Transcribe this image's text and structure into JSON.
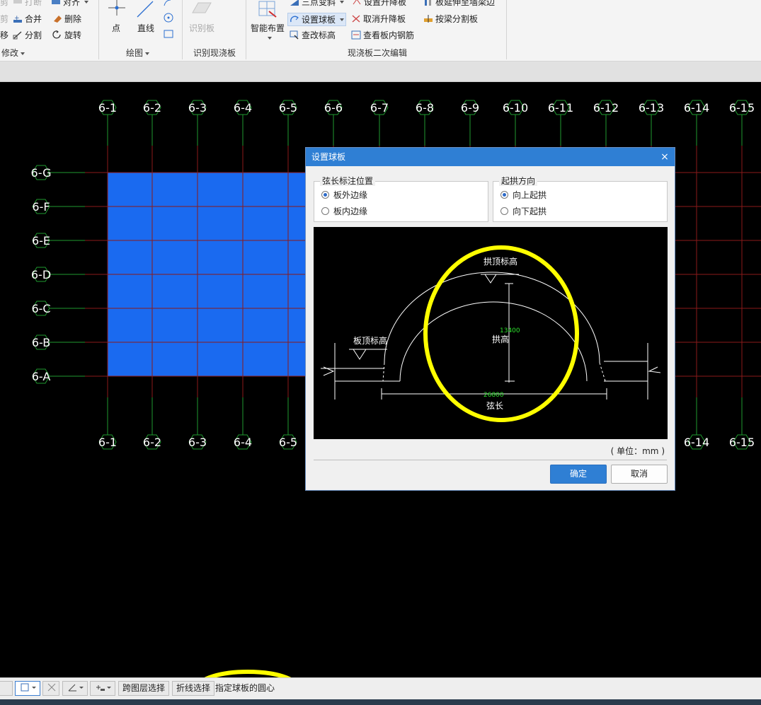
{
  "ribbon": {
    "modify": {
      "break": "打断",
      "align": "对齐",
      "merge": "合并",
      "delete": "删除",
      "split": "分割",
      "rotate": "旋转",
      "cut_partial": "剪",
      "move_partial": "移",
      "group_label": "修改"
    },
    "draw": {
      "point": "点",
      "line": "直线",
      "group_label": "绘图"
    },
    "identify": {
      "identify_slab": "识别板",
      "group_label": "识别现浇板"
    },
    "edit": {
      "smart_layout": "智能布置",
      "three_point_slope": "三点变斜",
      "set_lift_slab": "设置升降板",
      "extend_slab": "板延伸至墙梁边",
      "set_spherical_slab": "设置球板",
      "cancel_lift_slab": "取消升降板",
      "split_by_beam": "按梁分割板",
      "edit_elevation": "查改标高",
      "view_slab_rebar": "查看板内钢筋",
      "group_label": "现浇板二次编辑"
    }
  },
  "grid": {
    "top_axes": [
      "6-1",
      "6-2",
      "6-3",
      "6-4",
      "6-5",
      "6-6",
      "6-7",
      "6-8",
      "6-9",
      "6-10",
      "6-11",
      "6-12",
      "6-13",
      "6-14",
      "6-15"
    ],
    "bottom_axes": [
      "6-1",
      "6-2",
      "6-3",
      "6-4",
      "6-5",
      "6-14",
      "6-15"
    ],
    "left_axes": [
      "6-G",
      "6-F",
      "6-E",
      "6-D",
      "6-C",
      "6-B",
      "6-A"
    ]
  },
  "dialog": {
    "title": "设置球板",
    "close": "×",
    "chord_group": {
      "legend": "弦长标注位置",
      "options": [
        "板外边缘",
        "板内边缘"
      ],
      "selected": "板外边缘"
    },
    "arch_group": {
      "legend": "起拱方向",
      "options": [
        "向上起拱",
        "向下起拱"
      ],
      "selected": "向上起拱"
    },
    "preview": {
      "arch_top_elev": "拱顶标高",
      "slab_top_elev": "板顶标高",
      "rise_value": "13400",
      "rise_label": "拱高",
      "chord_value": "26800",
      "chord_label": "弦长"
    },
    "unit": "( 单位：mm )",
    "ok": "确定",
    "cancel": "取消"
  },
  "statusbar": {
    "cross_layer": "跨图层选择",
    "polyline_select": "折线选择",
    "prompt": "指定球板的圆心"
  },
  "colors": {
    "slab_fill": "#1a6af0",
    "axis_green": "#1f9a2f",
    "axis_red": "#8b1a1a",
    "annotation_yellow": "#ffff00",
    "dialog_title": "#2f7fd4"
  }
}
